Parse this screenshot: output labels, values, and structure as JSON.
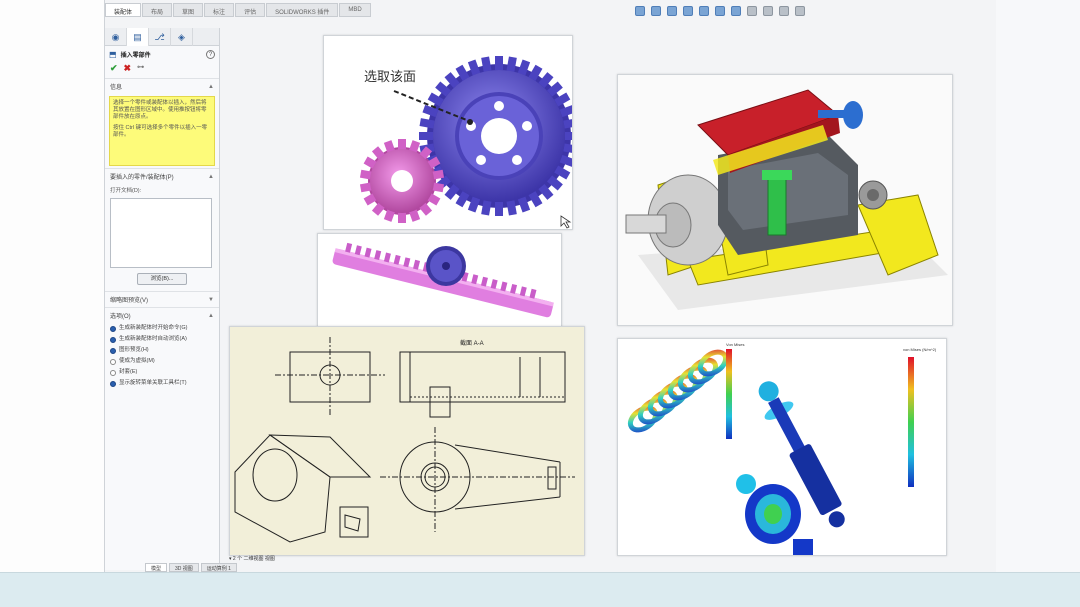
{
  "app": {
    "command_tabs": [
      "装配体",
      "布局",
      "草图",
      "标注",
      "评估",
      "SOLIDWORKS 插件",
      "MBD"
    ],
    "active_tab_index": 0
  },
  "property_manager": {
    "tabs": [
      "feature-manager",
      "property-manager",
      "configuration-manager",
      "display-manager"
    ],
    "title": "插入零部件",
    "help_label": "?",
    "ok_label": "✔",
    "cancel_label": "✖",
    "pin_label": "⊶",
    "message_section": "信息",
    "message_paragraph_1": "选择一个零件或装配体以插入，然后将其放置在图形区域中。使用推按钮将零部件放在原点。",
    "message_paragraph_2": "按住 Ctrl 键可选择多个零件以插入一零部件。",
    "parts_section": "要插入的零件/装配体(P)",
    "open_documents_label": "打开文档(D):",
    "browse_button": "浏览(B)...",
    "thumbnail_section": "缩略图预览(V)",
    "options_section": "选项(O)",
    "options": [
      {
        "label": "生成新装配体时开始命令(G)",
        "checked": true
      },
      {
        "label": "生成新装配体时自动浏览(A)",
        "checked": true
      },
      {
        "label": "图形预览(H)",
        "checked": true
      },
      {
        "label": "使成为虚拟(M)",
        "checked": false
      },
      {
        "label": "封套(E)",
        "checked": false
      },
      {
        "label": "显示旋转菜单关联工具栏(T)",
        "checked": true
      }
    ]
  },
  "bottom_tabs": [
    "模型",
    "3D 视图",
    "运动算例 1"
  ],
  "status_text": "▾ 2 个 二维视图 视图",
  "gear_image": {
    "annotation": "选取该面",
    "colors": {
      "large_gear": "#5a52c8",
      "small_gear": "#d96bd0"
    }
  },
  "rack_image": {
    "colors": {
      "rack": "#e07ee0",
      "pinion": "#4b46b8"
    }
  },
  "engine_image": {
    "colors": {
      "frame": "#f2e81e",
      "head": "#c8202a",
      "block": "#555a60"
    }
  },
  "simulation_image": {
    "legend_title_left": "Von Mises",
    "legend_title_right": "von Mises (N/m^2)"
  },
  "drawing_image": {
    "sheet_label": "截面 A-A",
    "colors": {
      "paper": "#f2efd9",
      "line": "#222222"
    }
  }
}
